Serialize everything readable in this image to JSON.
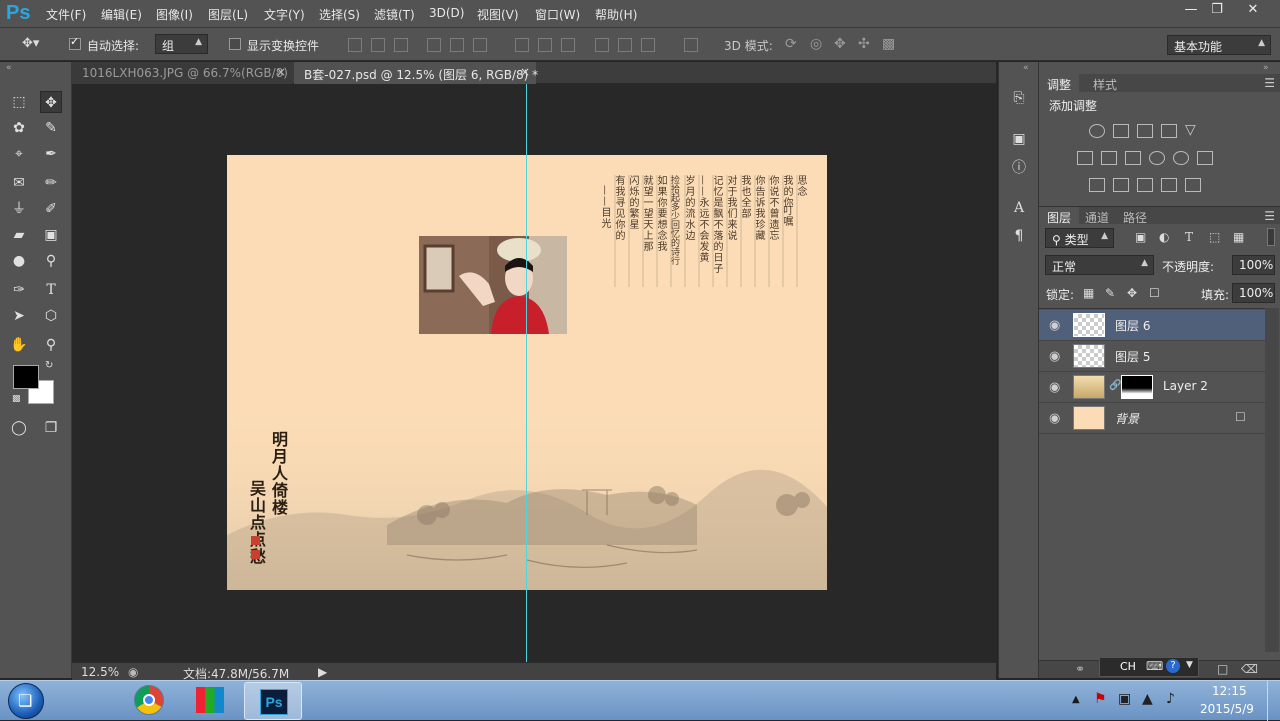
{
  "app": {
    "logo": "Ps"
  },
  "menu": [
    "文件(F)",
    "编辑(E)",
    "图像(I)",
    "图层(L)",
    "文字(Y)",
    "选择(S)",
    "滤镜(T)",
    "3D(D)",
    "视图(V)",
    "窗口(W)",
    "帮助(H)"
  ],
  "options": {
    "auto_select_label": "自动选择:",
    "auto_select_value": "组",
    "show_transform_label": "显示变换控件",
    "mode_3d_label": "3D 模式:",
    "workspace": "基本功能"
  },
  "tabs": [
    {
      "label": "1016LXH063.JPG @ 66.7%(RGB/8)",
      "close": "×"
    },
    {
      "label": "B套-027.psd @ 12.5% (图层 6, RGB/8) *",
      "close": "×"
    }
  ],
  "artwork": {
    "poem_lines": [
      "思念",
      "我的你",
      "叮嘱",
      "你说不曾遗忘",
      "你告诉我珍藏",
      "我也全部",
      "对于我们来说",
      "记忆是飘不落的日子",
      "——永远不会发黄",
      "岁月的流水边",
      "捡拾起多少回忆的诗行",
      "如果你要想念我",
      "就望一望天上那",
      "闪烁的繁星",
      "有我寻见你的",
      "——目光"
    ],
    "title_lines": [
      "明月人倚楼",
      "吴山点点愁"
    ]
  },
  "status": {
    "zoom": "12.5%",
    "doc_info": "文档:47.8M/56.7M"
  },
  "adjustments": {
    "tabs": [
      "调整",
      "样式"
    ],
    "heading": "添加调整"
  },
  "layers_panel": {
    "tabs": [
      "图层",
      "通道",
      "路径"
    ],
    "filter_kind": "类型",
    "blend_mode": "正常",
    "opacity_label": "不透明度:",
    "opacity_value": "100%",
    "lock_label": "锁定:",
    "fill_label": "填充:",
    "fill_value": "100%",
    "layers": [
      {
        "name": "图层 6",
        "selected": true
      },
      {
        "name": "图层 5",
        "selected": false
      },
      {
        "name": "Layer 2",
        "selected": false
      },
      {
        "name": "背景",
        "selected": false
      }
    ]
  },
  "taskbar": {
    "lang": "CH",
    "time": "12:15",
    "date": "2015/5/9",
    "active_app": "Ps"
  },
  "colors": {
    "ps_blue": "#29a8e0",
    "panel_bg": "#535353",
    "canvas_paper": "#fbdcb6",
    "guide": "#4fd5de",
    "selected_layer": "#51607a"
  }
}
